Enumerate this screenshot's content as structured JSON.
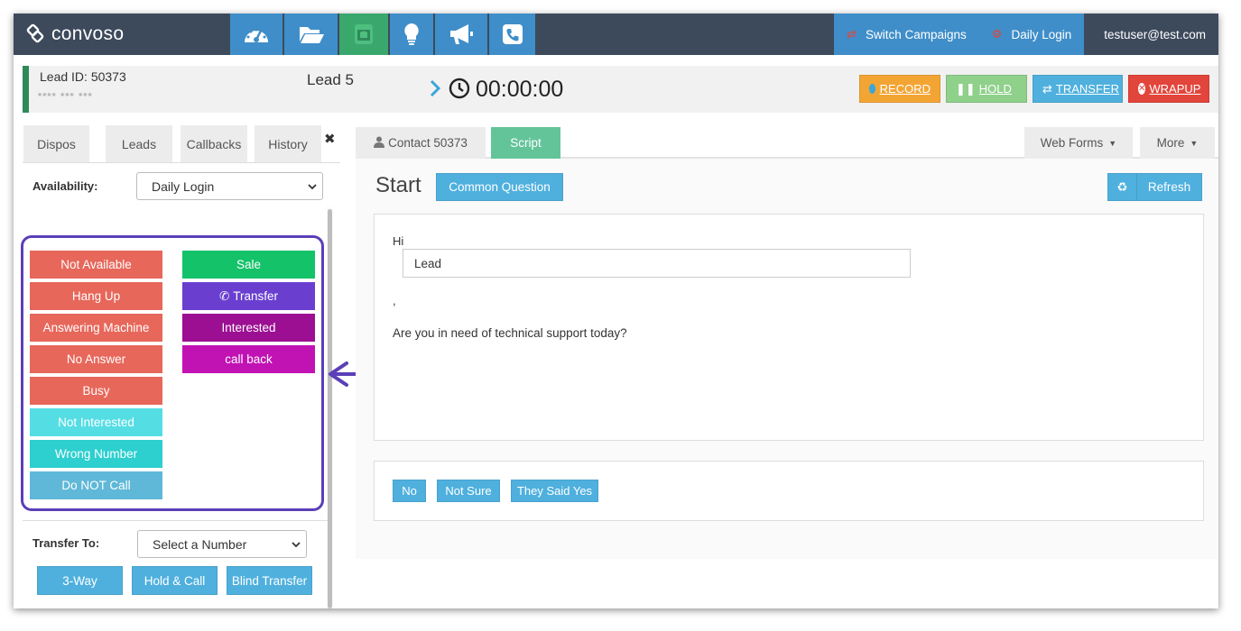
{
  "app": {
    "logo_text": "convoso"
  },
  "nav": {
    "icons": [
      "dashboard-icon",
      "folder-icon",
      "phone-booth-icon",
      "lightbulb-icon",
      "megaphone-icon",
      "phone-square-icon"
    ],
    "switch_campaigns": "Switch Campaigns",
    "daily_login": "Daily Login",
    "user": "testuser@test.com"
  },
  "lead": {
    "id_label": "Lead ID: 50373",
    "phone_masked": "•••• ••• •••",
    "name": "Lead 5",
    "timer": "00:00:00"
  },
  "actions": {
    "record": "RECORD",
    "hold": "HOLD",
    "transfer": "TRANSFER",
    "wrapup": "WRAPUP",
    "colors": {
      "record": "#f3a534",
      "hold": "#8fd08b",
      "transfer": "#4fb0de",
      "wrapup": "#e2453b"
    }
  },
  "left_tabs": [
    "Dispos",
    "Leads",
    "Callbacks",
    "History"
  ],
  "availability": {
    "label": "Availability:",
    "value": "Daily Login"
  },
  "dispositions_left": [
    {
      "label": "Not Available",
      "color": "#e7675a"
    },
    {
      "label": "Hang Up",
      "color": "#e7675a"
    },
    {
      "label": "Answering Machine",
      "color": "#e7675a"
    },
    {
      "label": "No Answer",
      "color": "#e7675a"
    },
    {
      "label": "Busy",
      "color": "#e7675a"
    },
    {
      "label": "Not Interested",
      "color": "#55dde4"
    },
    {
      "label": "Wrong Number",
      "color": "#2dcfcf"
    },
    {
      "label": "Do NOT Call",
      "color": "#5fb8d8"
    }
  ],
  "dispositions_right": [
    {
      "label": "Sale",
      "color": "#14c26a"
    },
    {
      "label": "Transfer",
      "color": "#6a3fd0"
    },
    {
      "label": "Interested",
      "color": "#9c0f93"
    },
    {
      "label": "call back",
      "color": "#c112b4"
    }
  ],
  "transfer": {
    "label": "Transfer To:",
    "select_value": "Select a Number",
    "buttons": [
      "3-Way",
      "Hold & Call",
      "Blind Transfer"
    ]
  },
  "right_tabs": {
    "contact": "Contact 50373",
    "script": "Script",
    "web_forms": "Web Forms",
    "more": "More"
  },
  "script": {
    "heading": "Start",
    "common_question": "Common Question",
    "refresh": "Refresh",
    "greeting": "Hi",
    "lead_field_value": "Lead",
    "comma": ",",
    "question": "Are you in need of technical support today?",
    "answers": [
      "No",
      "Not Sure",
      "They Said Yes"
    ]
  }
}
